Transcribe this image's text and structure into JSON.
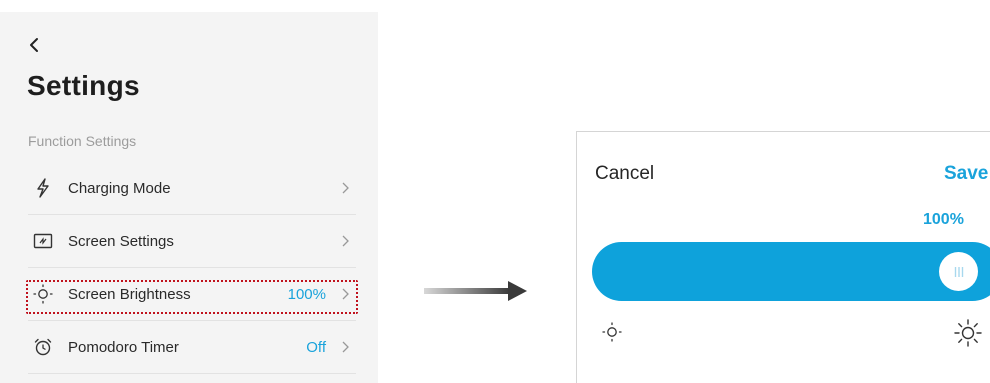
{
  "settings": {
    "title": "Settings",
    "section_title": "Function Settings",
    "items": [
      {
        "label": "Charging Mode",
        "value": "",
        "icon": "lightning-icon"
      },
      {
        "label": "Screen Settings",
        "value": "",
        "icon": "screen-icon"
      },
      {
        "label": "Screen Brightness",
        "value": "100%",
        "icon": "sun-small-icon"
      },
      {
        "label": "Pomodoro Timer",
        "value": "Off",
        "icon": "alarm-clock-icon"
      }
    ]
  },
  "brightness": {
    "cancel_label": "Cancel",
    "save_label": "Save",
    "value_label": "100%",
    "level": 1.0
  },
  "colors": {
    "accent": "#1aa3db",
    "slider": "#0ea2db",
    "highlight": "#c0121d",
    "panel_bg": "#f4f4f4"
  }
}
